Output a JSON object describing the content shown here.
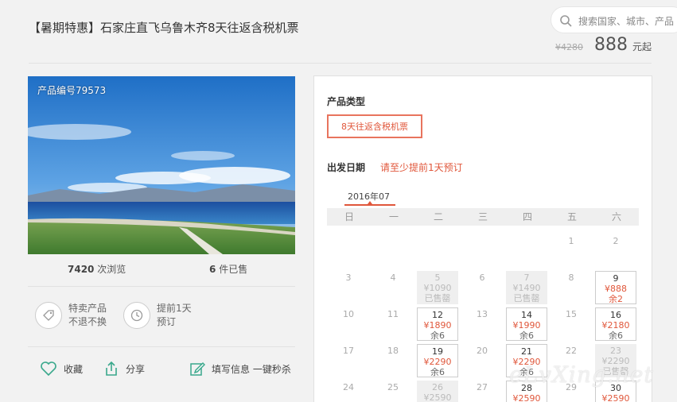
{
  "header": {
    "title": "【暑期特惠】石家庄直飞乌鲁木齐8天往返含税机票",
    "search_placeholder": "搜索国家、城市、产品",
    "old_price": "¥4280",
    "price": "888",
    "price_unit": "元起"
  },
  "product": {
    "id_label": "产品编号79573",
    "views_count": "7420",
    "views_label": "次浏览",
    "sold_count": "6",
    "sold_label": "件已售",
    "features": [
      {
        "line1": "特卖产品",
        "line2": "不退不换",
        "icon": "tag-icon"
      },
      {
        "line1": "提前1天",
        "line2": "预订",
        "icon": "clock-icon"
      }
    ],
    "actions": {
      "favorite": "收藏",
      "share": "分享",
      "quick_order": "填写信息 一键秒杀"
    }
  },
  "booking": {
    "type_label": "产品类型",
    "type_option": "8天往返含税机票",
    "date_label": "出发日期",
    "date_note": "请至少提前1天预订",
    "month": "2016年07",
    "weekdays": [
      "日",
      "一",
      "二",
      "三",
      "四",
      "五",
      "六"
    ],
    "days": [
      {
        "d": "",
        "s": "empty"
      },
      {
        "d": "",
        "s": "empty"
      },
      {
        "d": "",
        "s": "empty"
      },
      {
        "d": "",
        "s": "empty"
      },
      {
        "d": "",
        "s": "empty"
      },
      {
        "d": "1",
        "s": "plain"
      },
      {
        "d": "2",
        "s": "plain"
      },
      {
        "d": "3",
        "s": "plain"
      },
      {
        "d": "4",
        "s": "plain"
      },
      {
        "d": "5",
        "p": "¥1090",
        "r": "已售罄",
        "s": "sold"
      },
      {
        "d": "6",
        "s": "plain"
      },
      {
        "d": "7",
        "p": "¥1490",
        "r": "已售罄",
        "s": "sold"
      },
      {
        "d": "8",
        "s": "plain"
      },
      {
        "d": "9",
        "p": "¥888",
        "r": "余2",
        "s": "avail",
        "rred": true
      },
      {
        "d": "10",
        "s": "plain"
      },
      {
        "d": "11",
        "s": "plain"
      },
      {
        "d": "12",
        "p": "¥1890",
        "r": "余6",
        "s": "avail"
      },
      {
        "d": "13",
        "s": "plain"
      },
      {
        "d": "14",
        "p": "¥1990",
        "r": "余6",
        "s": "avail"
      },
      {
        "d": "15",
        "s": "plain"
      },
      {
        "d": "16",
        "p": "¥2180",
        "r": "余6",
        "s": "avail"
      },
      {
        "d": "17",
        "s": "plain"
      },
      {
        "d": "18",
        "s": "plain"
      },
      {
        "d": "19",
        "p": "¥2290",
        "r": "余6",
        "s": "avail"
      },
      {
        "d": "20",
        "s": "plain"
      },
      {
        "d": "21",
        "p": "¥2290",
        "r": "余6",
        "s": "avail"
      },
      {
        "d": "22",
        "s": "plain"
      },
      {
        "d": "23",
        "p": "¥2290",
        "r": "已售罄",
        "s": "sold"
      },
      {
        "d": "24",
        "s": "plain"
      },
      {
        "d": "25",
        "s": "plain"
      },
      {
        "d": "26",
        "p": "¥2590",
        "r": "",
        "s": "sold"
      },
      {
        "d": "27",
        "s": "plain"
      },
      {
        "d": "28",
        "p": "¥2590",
        "r": "",
        "s": "avail"
      },
      {
        "d": "29",
        "s": "plain"
      },
      {
        "d": "30",
        "p": "¥2590",
        "r": "",
        "s": "avail"
      }
    ]
  },
  "watermark": "eLvXing.net",
  "colors": {
    "accent": "#e0573b",
    "icon_green": "#3aa88c"
  }
}
